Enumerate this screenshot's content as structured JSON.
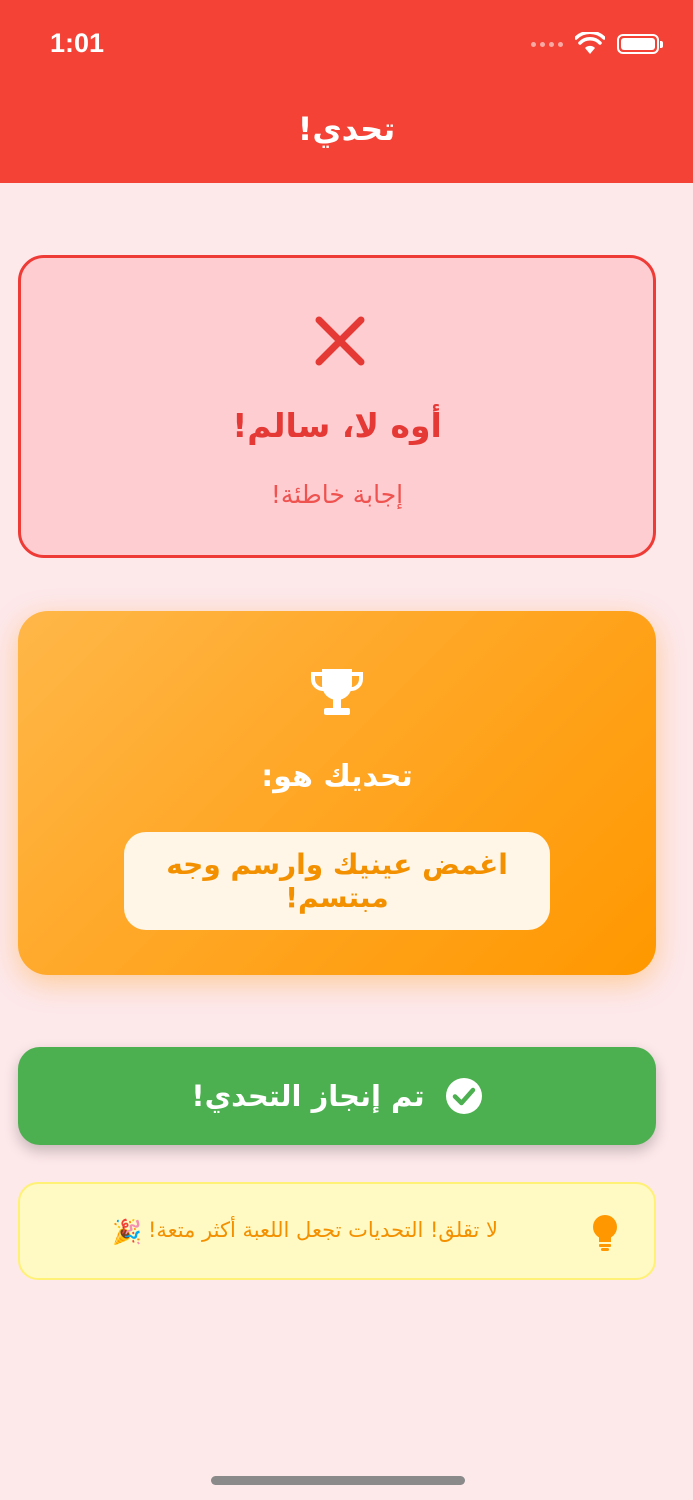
{
  "status_bar": {
    "time": "1:01",
    "icons": [
      "signal-dots-icon",
      "wifi-icon",
      "battery-icon"
    ]
  },
  "header": {
    "title": "تحدي!",
    "color": "#f44336"
  },
  "result": {
    "icon": "close-icon",
    "title": "أوه لا، سالم!",
    "subtitle": "إجابة خاطئة!"
  },
  "challenge": {
    "icon": "trophy-icon",
    "label": "تحديك هو:",
    "text": "اغمض عينيك وارسم وجه مبتسم!"
  },
  "done_button": {
    "icon": "check-circle-icon",
    "label": "تم إنجاز التحدي!",
    "color": "#4caf50"
  },
  "tip": {
    "icon": "lightbulb-icon",
    "text": "لا تقلق! التحديات تجعل اللعبة أكثر متعة!",
    "emoji": "🎉"
  },
  "colors": {
    "background": "#fde8ea",
    "error": "#e53935",
    "accent_orange": "#ff9800"
  }
}
